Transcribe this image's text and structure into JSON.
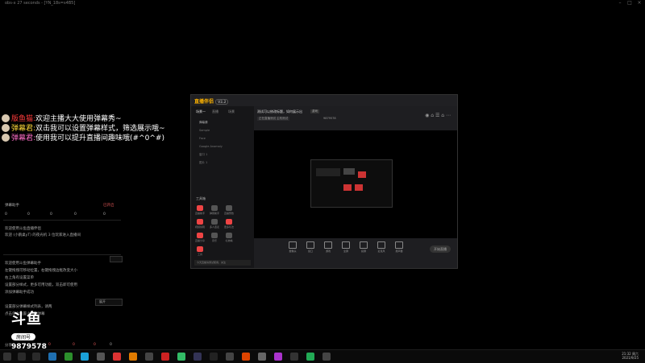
{
  "window": {
    "title": "obs-x 27 seconds - [YN_18s=s4B5]"
  },
  "danmaku": [
    {
      "nick": "版鱼猫:",
      "text": "欢迎主播大大使用弹幕秀~"
    },
    {
      "nick": "弹幕君:",
      "text": "双击我可以设置弹幕样式，筛选展示哦~"
    },
    {
      "nick": "弹幕君:",
      "text": "使用我可以提升直播间趣味哦(#^0^#)"
    }
  ],
  "chat": {
    "header_left": "弹幕助手",
    "header_right": "已开启",
    "stats": [
      "0",
      "0",
      "0",
      "0",
      "0"
    ],
    "welcome1": "欢迎使用斗鱼直播伴侣",
    "welcome2": "欢迎 (小鹅桌yT) 的夜光机 3 位玩家进入直播间",
    "tips": [
      "欢迎使用斗鱼弹幕助手",
      "左键拖拽可移动位置，右键拖拽边框改变大小",
      "右上角有设置菜单",
      "设置部分样式，更多可用功能，双击即可使用",
      "添加弹幕助手成功"
    ],
    "box_label": "展开",
    "notice1": "设置部分弹幕样式列表，请两",
    "notice2": "点击单个设置小礼物弹幕",
    "footer": [
      "分享",
      "0",
      "0",
      "0",
      "0"
    ]
  },
  "logo": {
    "brand": "斗鱼",
    "room_label": "房间号",
    "room_number": "9879578"
  },
  "app": {
    "brand": "直播伴侣",
    "version": "V2.2",
    "tabs": [
      "场景一",
      "直播",
      "场景"
    ],
    "sources": [
      "弹幕源",
      "Sample",
      "Face",
      "Google Anomaly",
      "窗口 1",
      "图片 1"
    ],
    "tools_title": "工具箱",
    "tools": [
      "直播助手",
      "弹幕助手",
      "直播预告",
      "视频剪辑",
      "多人连麦",
      "更多玩法",
      "直播分享",
      "音乐",
      "礼物墙",
      "工具"
    ],
    "stream_title": "测试可以修改标题，如何展示出",
    "tag": "游戏",
    "sub": "正在直播测试   主机测试",
    "viewers": "9879578",
    "bottom_tools": [
      "摄像头",
      "窗口",
      "游戏",
      "全屏",
      "投屏",
      "麦克风",
      "扬声器"
    ],
    "start_label": "开始直播",
    "notice": "今天直播请测试使用，关注"
  },
  "taskbar": {
    "time": "21:32 周六",
    "date": "2021/9/25"
  }
}
